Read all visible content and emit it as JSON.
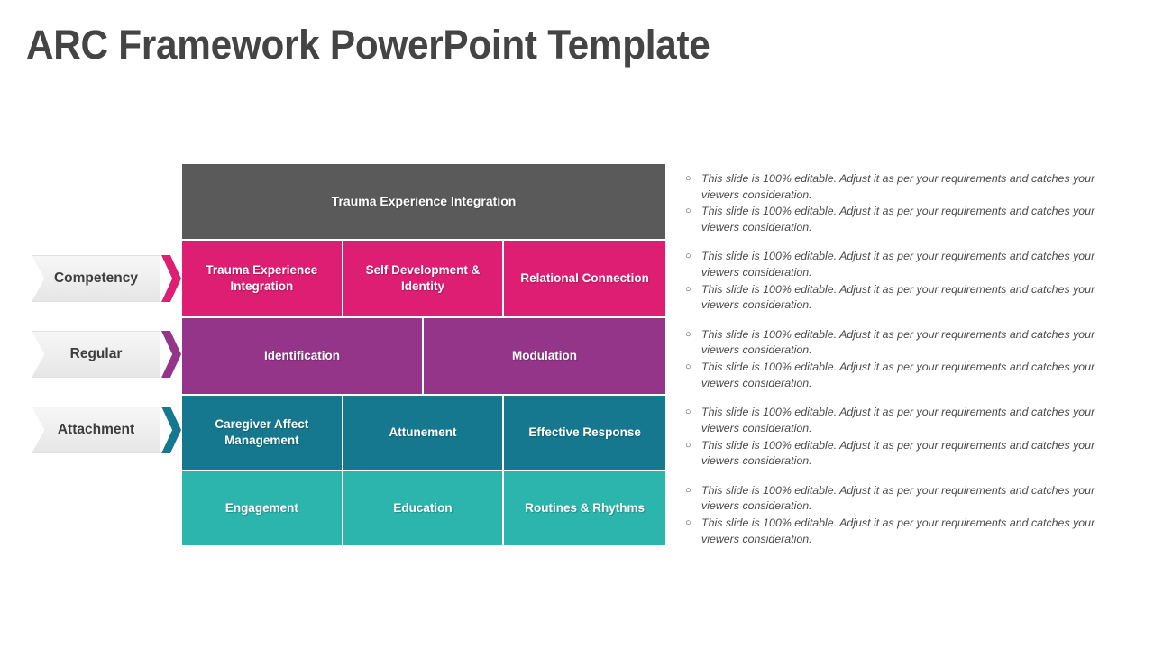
{
  "slide": {
    "title": "ARC Framework PowerPoint Template"
  },
  "colors": {
    "header_gray": "#5a5a5a",
    "pink": "#dd1e73",
    "purple": "#943589",
    "teal_dark": "#15788f",
    "teal_light": "#2bb5ac",
    "title_text": "#444444",
    "label_text": "#3d3d3d",
    "bullet_text": "#4a4a4a"
  },
  "side_labels": [
    {
      "text": "Competency",
      "accent": "#dd1e73"
    },
    {
      "text": "Regular",
      "accent": "#943589"
    },
    {
      "text": "Attachment",
      "accent": "#15788f"
    }
  ],
  "matrix": {
    "header": {
      "text": "Trauma Experience Integration",
      "color": "#5a5a5a"
    },
    "rows": [
      {
        "color": "#dd1e73",
        "cells": [
          {
            "text": "Trauma Experience Integration"
          },
          {
            "text": "Self Development & Identity"
          },
          {
            "text": "Relational Connection"
          }
        ]
      },
      {
        "color": "#943589",
        "cells": [
          {
            "text": "Identification"
          },
          {
            "text": "Modulation"
          }
        ]
      },
      {
        "color": "#15788f",
        "cells": [
          {
            "text": "Caregiver Affect Management"
          },
          {
            "text": "Attunement"
          },
          {
            "text": "Effective Response"
          }
        ]
      },
      {
        "color": "#2bb5ac",
        "cells": [
          {
            "text": "Engagement"
          },
          {
            "text": "Education"
          },
          {
            "text": "Routines & Rhythms"
          }
        ]
      }
    ]
  },
  "notes": {
    "bullet_marker": "○",
    "groups": [
      {
        "items": [
          "This slide is 100% editable. Adjust it as per your requirements and catches your viewers consideration.",
          "This slide is 100% editable. Adjust it as per your requirements and catches your viewers consideration."
        ]
      },
      {
        "items": [
          "This slide is 100% editable. Adjust it as per your requirements and catches your viewers consideration.",
          "This slide is 100% editable. Adjust it as per your requirements and catches your viewers consideration."
        ]
      },
      {
        "items": [
          "This slide is 100% editable. Adjust it as per your requirements and catches your viewers consideration.",
          "This slide is 100% editable. Adjust it as per your requirements and catches your viewers consideration."
        ]
      },
      {
        "items": [
          "This slide is 100% editable. Adjust it as per your requirements and catches your viewers consideration.",
          "This slide is 100% editable. Adjust it as per your requirements and catches your viewers consideration."
        ]
      },
      {
        "items": [
          "This slide is 100% editable. Adjust it as per your requirements and catches your viewers consideration.",
          "This slide is 100% editable. Adjust it as per your requirements and catches your viewers consideration."
        ]
      }
    ]
  }
}
